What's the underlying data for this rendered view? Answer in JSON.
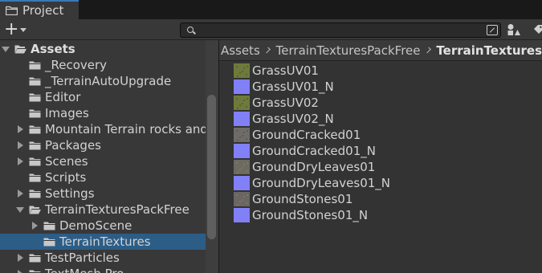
{
  "window": {
    "tab_label": "Project",
    "tab_icon": "folder-icon"
  },
  "toolbar": {
    "create_label": "+",
    "search": {
      "value": "",
      "placeholder": ""
    }
  },
  "tree": {
    "items": [
      {
        "label": "Assets",
        "depth": 0,
        "expanded": true,
        "has_children": true,
        "bold": true,
        "selected": false
      },
      {
        "label": "_Recovery",
        "depth": 1,
        "expanded": false,
        "has_children": false,
        "bold": false,
        "selected": false
      },
      {
        "label": "_TerrainAutoUpgrade",
        "depth": 1,
        "expanded": false,
        "has_children": false,
        "bold": false,
        "selected": false
      },
      {
        "label": "Editor",
        "depth": 1,
        "expanded": false,
        "has_children": false,
        "bold": false,
        "selected": false
      },
      {
        "label": "Images",
        "depth": 1,
        "expanded": false,
        "has_children": false,
        "bold": false,
        "selected": false
      },
      {
        "label": "Mountain Terrain rocks and tr",
        "depth": 1,
        "expanded": false,
        "has_children": true,
        "bold": false,
        "selected": false
      },
      {
        "label": "Packages",
        "depth": 1,
        "expanded": false,
        "has_children": true,
        "bold": false,
        "selected": false
      },
      {
        "label": "Scenes",
        "depth": 1,
        "expanded": false,
        "has_children": true,
        "bold": false,
        "selected": false
      },
      {
        "label": "Scripts",
        "depth": 1,
        "expanded": false,
        "has_children": false,
        "bold": false,
        "selected": false
      },
      {
        "label": "Settings",
        "depth": 1,
        "expanded": false,
        "has_children": true,
        "bold": false,
        "selected": false
      },
      {
        "label": "TerrainTexturesPackFree",
        "depth": 1,
        "expanded": true,
        "has_children": true,
        "bold": false,
        "selected": false
      },
      {
        "label": "DemoScene",
        "depth": 2,
        "expanded": false,
        "has_children": true,
        "bold": false,
        "selected": false
      },
      {
        "label": "TerrainTextures",
        "depth": 2,
        "expanded": false,
        "has_children": false,
        "bold": false,
        "selected": true
      },
      {
        "label": "TestParticles",
        "depth": 1,
        "expanded": false,
        "has_children": true,
        "bold": false,
        "selected": false
      },
      {
        "label": "TextMesh Pro",
        "depth": 1,
        "expanded": false,
        "has_children": true,
        "bold": false,
        "selected": false
      }
    ]
  },
  "breadcrumb": [
    "Assets",
    "TerrainTexturesPackFree",
    "TerrainTextures"
  ],
  "files": [
    {
      "label": "GrassUV01",
      "kind": "grass"
    },
    {
      "label": "GrassUV01_N",
      "kind": "normal"
    },
    {
      "label": "GrassUV02",
      "kind": "grass"
    },
    {
      "label": "GrassUV02_N",
      "kind": "normal"
    },
    {
      "label": "GroundCracked01",
      "kind": "cracked"
    },
    {
      "label": "GroundCracked01_N",
      "kind": "normal"
    },
    {
      "label": "GroundDryLeaves01",
      "kind": "leaves"
    },
    {
      "label": "GroundDryLeaves01_N",
      "kind": "normal"
    },
    {
      "label": "GroundStones01",
      "kind": "stones"
    },
    {
      "label": "GroundStones01_N",
      "kind": "normal"
    }
  ],
  "colors": {
    "selection": "#2c5d87",
    "tab_accent": "#3a79bb",
    "folder": "#c8c8c8",
    "grass_texture": "#6e7a3c",
    "normal_map": "#8180f6",
    "cracked_texture": "#6f6b68",
    "leaves_texture": "#6d6a5f",
    "stones_texture": "#6b6661"
  }
}
